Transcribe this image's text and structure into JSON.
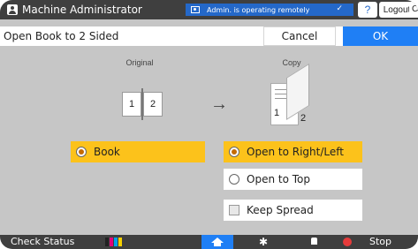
{
  "topbar": {
    "user": "Machine Administrator",
    "remote_msg": "Admin. is operating remotely",
    "remote_check": "✓",
    "help": "?",
    "logout": "Logout",
    "cut": "C"
  },
  "header": {
    "title": "Open Book to 2 Sided",
    "cancel": "Cancel",
    "ok": "OK"
  },
  "diagram": {
    "original_label": "Original",
    "copy_label": "Copy",
    "left_page": "1",
    "right_page": "2",
    "arrow": "→",
    "copy_front": "1",
    "copy_back": "2"
  },
  "options": {
    "book": {
      "label": "Book",
      "selected": true
    },
    "open_right_left": {
      "label": "Open to Right/Left",
      "selected": true
    },
    "open_top": {
      "label": "Open to Top",
      "selected": false
    },
    "keep_spread": {
      "label": "Keep Spread",
      "checked": false
    }
  },
  "bottombar": {
    "check_status": "Check Status",
    "stop": "Stop",
    "gear": "✱",
    "toner_colors": [
      "#222222",
      "#e2007a",
      "#00a0e9",
      "#f5d000"
    ]
  },
  "colors": {
    "accent": "#1f7ff5",
    "selected": "#fcc21b",
    "background": "#c6c6c6",
    "bar": "#3f3f3f"
  }
}
